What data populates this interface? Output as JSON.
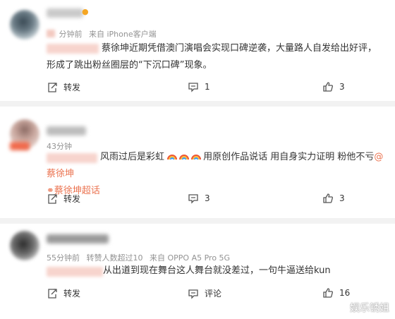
{
  "comments": [
    {
      "time": "分钟前",
      "source": "来自 iPhone客户端",
      "text": "蔡徐坤近期凭借澳门演唱会实现口碑逆袭，大量路人自发给出好评，形成了跳出粉丝圈层的“下沉口碑”现象。",
      "actions": {
        "share": "转发",
        "comment_count": "1",
        "like_count": "3"
      }
    },
    {
      "time": "43分钟",
      "text_main": "风雨过后是彩虹",
      "text_after": "用原创作品说话 用自身实力证明 粉他不亏",
      "mention": "@蔡徐坤",
      "topic": "蔡徐坤超话",
      "actions": {
        "share": "转发",
        "comment_count": "3",
        "like_count": "3"
      }
    },
    {
      "time": "55分钟前",
      "repost_info": "转赞人数超过10",
      "source": "来自 OPPO A5 Pro 5G",
      "text": "从出道到现在舞台这人舞台就没差过，一句牛逼送给kun",
      "actions": {
        "share": "转发",
        "comment": "评论",
        "like_count": "16"
      }
    }
  ],
  "watermark": "娱乐锈姐",
  "colors": {
    "link": "#eb7350",
    "meta": "#939393",
    "divider": "#f2f2f2"
  }
}
